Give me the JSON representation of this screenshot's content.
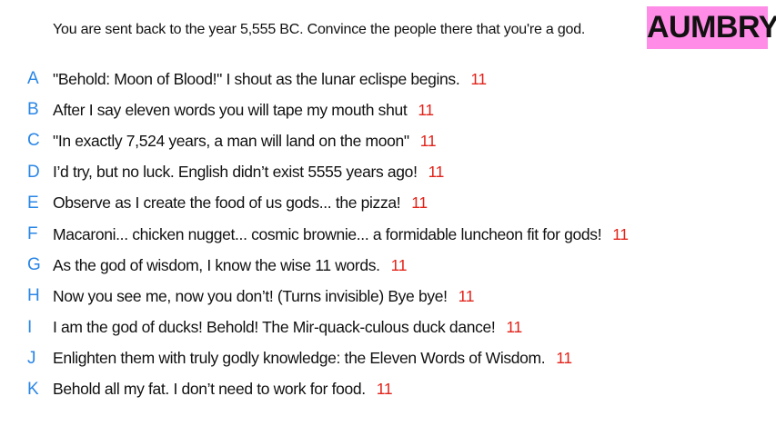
{
  "prompt": "You are sent back to the year 5,555 BC. Convince the people there that you're a god.",
  "brand": "AUMBRY",
  "colors": {
    "letter": "#2a86e6",
    "score": "#e2231a",
    "brand_bg": "#ff8ce6",
    "text": "#111111"
  },
  "answers": [
    {
      "letter": "A",
      "text": "\"Behold: Moon of Blood!\" I shout as the lunar eclispe begins.",
      "score": "11"
    },
    {
      "letter": "B",
      "text": "After I say eleven words you will tape my mouth shut",
      "score": "11"
    },
    {
      "letter": "C",
      "text": "\"In exactly 7,524 years, a man will land on the moon\"",
      "score": "11"
    },
    {
      "letter": "D",
      "text": "I’d try, but no luck. English didn’t exist 5555 years ago!",
      "score": "11"
    },
    {
      "letter": "E",
      "text": "Observe as I create the food of us gods... the pizza!",
      "score": "11"
    },
    {
      "letter": "F",
      "text": "Macaroni... chicken nugget... cosmic brownie...  a formidable luncheon fit for gods!",
      "score": "11"
    },
    {
      "letter": "G",
      "text": "As the god of wisdom, I know the wise 11 words.",
      "score": "11"
    },
    {
      "letter": "H",
      "text": "Now you see me, now you don’t! (Turns invisible) Bye bye!",
      "score": "11"
    },
    {
      "letter": "I",
      "text": "I am the god of ducks! Behold! The Mir-quack-culous duck dance!",
      "score": "11"
    },
    {
      "letter": "J",
      "text": "Enlighten them with truly godly knowledge: the Eleven Words of Wisdom.",
      "score": "11"
    },
    {
      "letter": "K",
      "text": "Behold all my fat. I don’t need to work for food.",
      "score": "11"
    }
  ]
}
